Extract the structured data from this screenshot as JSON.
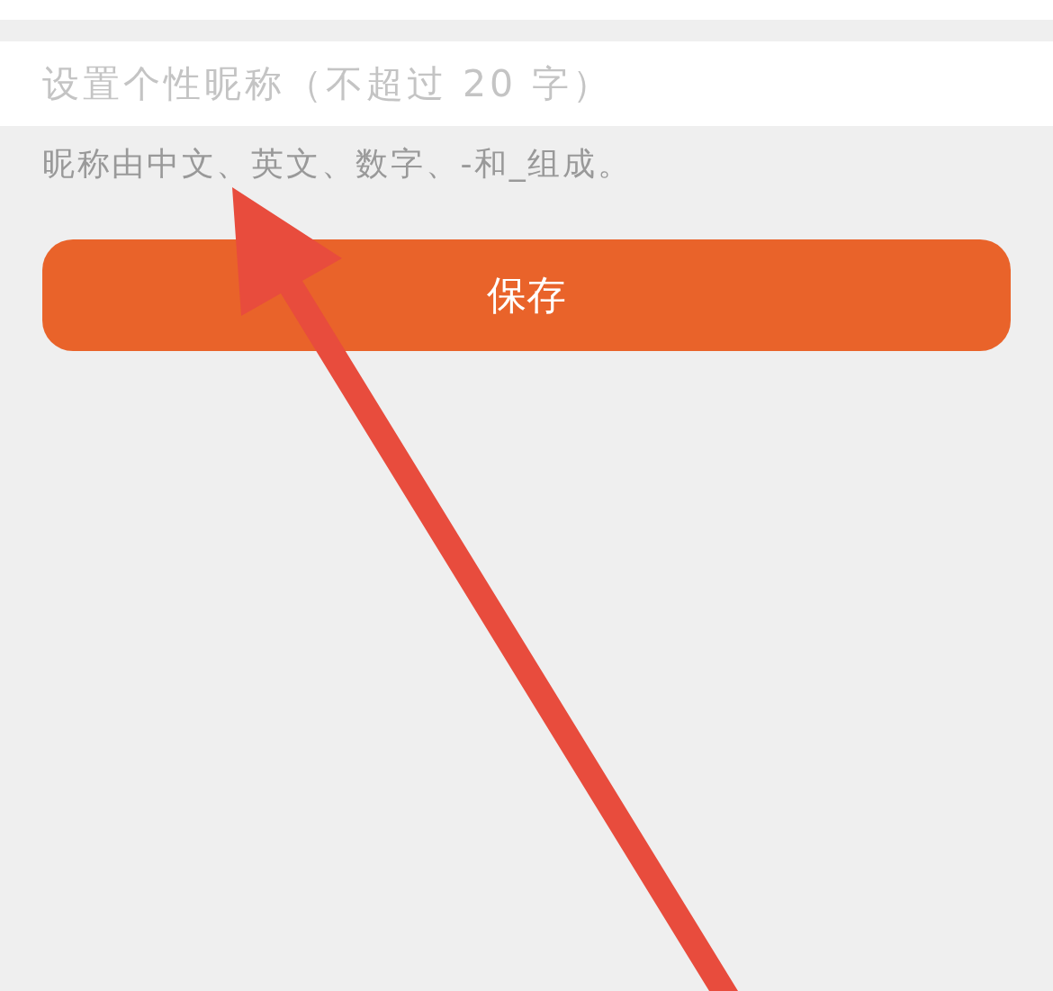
{
  "nickname_field": {
    "placeholder": "设置个性昵称（不超过 20 字）"
  },
  "hint": "昵称由中文、英文、数字、-和_组成。",
  "save_button": {
    "label": "保存"
  },
  "annotation": {
    "kind": "arrow"
  }
}
